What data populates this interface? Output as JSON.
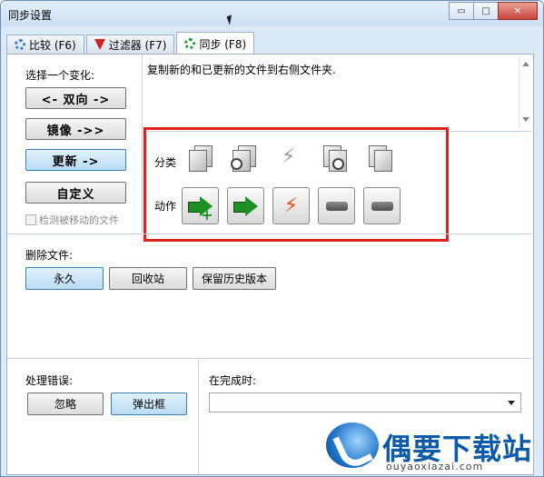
{
  "window": {
    "title": "同步设置",
    "minimize": "▭",
    "maximize": "□",
    "close": "✕"
  },
  "tabs": [
    {
      "label": "比较 (F6)"
    },
    {
      "label": "过滤器 (F7)"
    },
    {
      "label": "同步 (F8)"
    }
  ],
  "variant": {
    "heading": "选择一个变化:",
    "buttons": [
      {
        "label": "<- 双向 ->"
      },
      {
        "label": "镜像 ->>"
      },
      {
        "label": "更新 ->"
      },
      {
        "label": "自定义"
      }
    ],
    "selected": "更新 ->",
    "detect_moved": "检测被移动的文件"
  },
  "description": "复制新的和已更新的文件到右侧文件夹.",
  "rules": {
    "category_label": "分类",
    "action_label": "动作"
  },
  "delete": {
    "heading": "删除文件:",
    "buttons": [
      {
        "label": "永久"
      },
      {
        "label": "回收站"
      },
      {
        "label": "保留历史版本"
      }
    ],
    "selected": "永久"
  },
  "errors": {
    "heading": "处理错误:",
    "buttons": [
      {
        "label": "忽略"
      },
      {
        "label": "弹出框"
      }
    ],
    "selected": "弹出框"
  },
  "completion": {
    "heading": "在完成时:",
    "value": ""
  },
  "watermark": {
    "brand": "偶要下载站",
    "domain": "ouyaoxiazai.com"
  }
}
